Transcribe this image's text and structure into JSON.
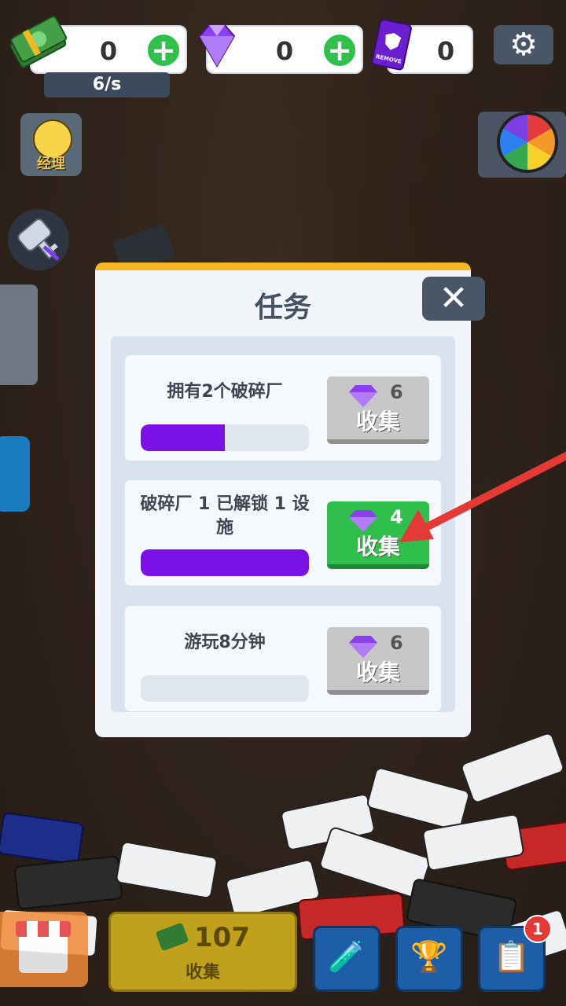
{
  "hud": {
    "cash_value": "0",
    "gem_value": "0",
    "remove_value": "0",
    "rate": "6/s",
    "remove_card_label": "REMOVE",
    "manager_label": "经理"
  },
  "dialog": {
    "title": "任务",
    "close_glyph": "✕",
    "tasks": [
      {
        "name": "拥有2个破碎厂",
        "progress": 0.5,
        "reward": "6",
        "button_label": "收集",
        "state": "locked"
      },
      {
        "name": "破碎厂 1 已解锁 1 设施",
        "progress": 1.0,
        "reward": "4",
        "button_label": "收集",
        "state": "ready"
      },
      {
        "name": "游玩8分钟",
        "progress": 0.0,
        "reward": "6",
        "button_label": "收集",
        "state": "locked"
      }
    ]
  },
  "bottom": {
    "collect_amount": "107",
    "collect_label": "收集",
    "tasks_badge": "1"
  },
  "colors": {
    "accent_yellow": "#f5b820",
    "progress_purple": "#7a12e8",
    "ready_green": "#2fbf4a",
    "pointer_red": "#e53935"
  }
}
